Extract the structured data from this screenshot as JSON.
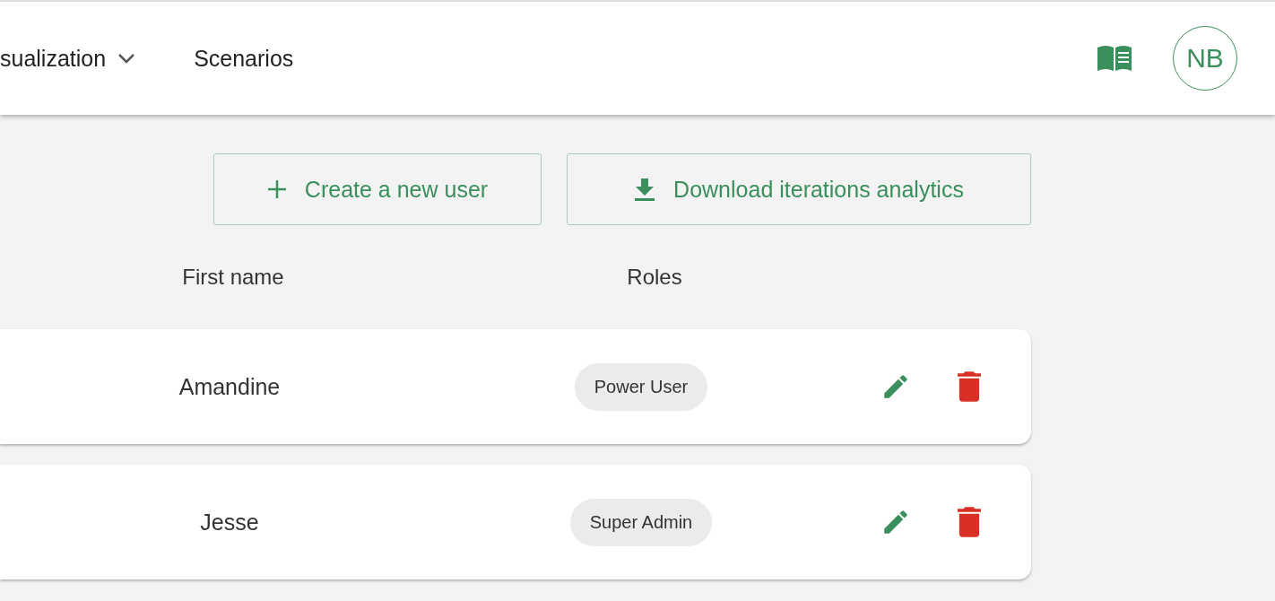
{
  "nav": [
    {
      "label": "sualization",
      "dropdown": true
    },
    {
      "label": "Scenarios",
      "dropdown": false
    }
  ],
  "avatar": {
    "initials": "NB"
  },
  "actions": [
    {
      "kind": "create",
      "label": "Create a new user"
    },
    {
      "kind": "download",
      "label": "Download iterations analytics"
    }
  ],
  "columns": [
    "First name",
    "Roles"
  ],
  "users": [
    {
      "first_name": "Amandine",
      "role": "Power User"
    },
    {
      "first_name": "Jesse",
      "role": "Super Admin"
    }
  ]
}
